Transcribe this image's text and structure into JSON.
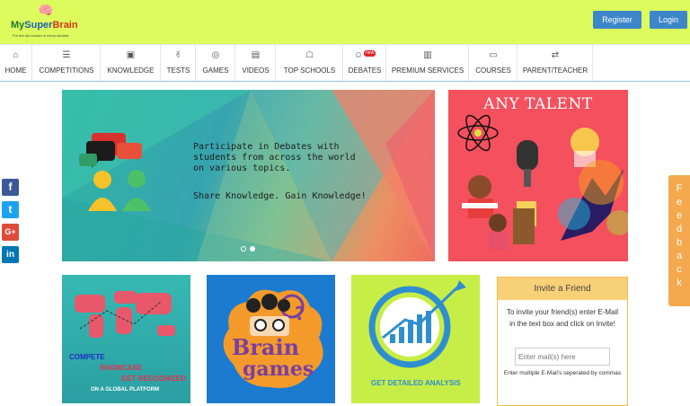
{
  "header": {
    "logo_text_my": "My",
    "logo_text_super": "Super",
    "logo_text_brain": "Brain",
    "logo_tagline": "For the all-rounder in every student",
    "register_label": "Register",
    "login_label": "Login",
    "bg_color": "#ddfb5c",
    "button_color": "#3d86c9"
  },
  "nav": {
    "items": [
      {
        "label": "HOME",
        "icon": "home-icon"
      },
      {
        "label": "COMPETITIONS",
        "icon": "list-icon"
      },
      {
        "label": "KNOWLEDGE",
        "icon": "archive-icon"
      },
      {
        "label": "TESTS",
        "icon": "thumbs-up-icon"
      },
      {
        "label": "GAMES",
        "icon": "gamepad-icon"
      },
      {
        "label": "VIDEOS",
        "icon": "film-icon"
      },
      {
        "label": "TOP SCHOOLS",
        "icon": "institution-icon"
      },
      {
        "label": "DEBATES",
        "icon": "group-icon",
        "badge": "new"
      },
      {
        "label": "PREMIUM SERVICES",
        "icon": "book-icon"
      },
      {
        "label": "COURSES",
        "icon": "credit-card-icon"
      },
      {
        "label": "PARENT/TEACHER",
        "icon": "exchange-icon"
      }
    ]
  },
  "hero": {
    "line1": "Participate in Debates with",
    "line2": "students from across the world",
    "line3": "on various topics.",
    "line4": "Share Knowledge. Gain Knowledge!",
    "active_slide": 2,
    "slide_count": 2
  },
  "talent": {
    "title": "ANY TALENT"
  },
  "feedback": {
    "letters": [
      "F",
      "e",
      "e",
      "d",
      "b",
      "a",
      "c",
      "k"
    ]
  },
  "cards": {
    "compete_line1": "COMPETE",
    "compete_line2": "SHOWCASE",
    "compete_line3": "GET RECOGNIZED",
    "compete_line4": "ON A GLOBAL PLATFORM",
    "brain_line1": "Brain",
    "brain_line2": "games",
    "analysis_label": "GET DETAILED ANALYSIS"
  },
  "invite": {
    "title": "Invite a Friend",
    "description": "To invite your friend(s) enter E-Mail in the text box and click on Invite!",
    "input_placeholder": "Enter mail(s) here",
    "note": "Enter multiple E-Mail's seperated by commas"
  },
  "social": [
    "facebook-icon",
    "twitter-icon",
    "google-plus-icon",
    "linkedin-icon"
  ]
}
